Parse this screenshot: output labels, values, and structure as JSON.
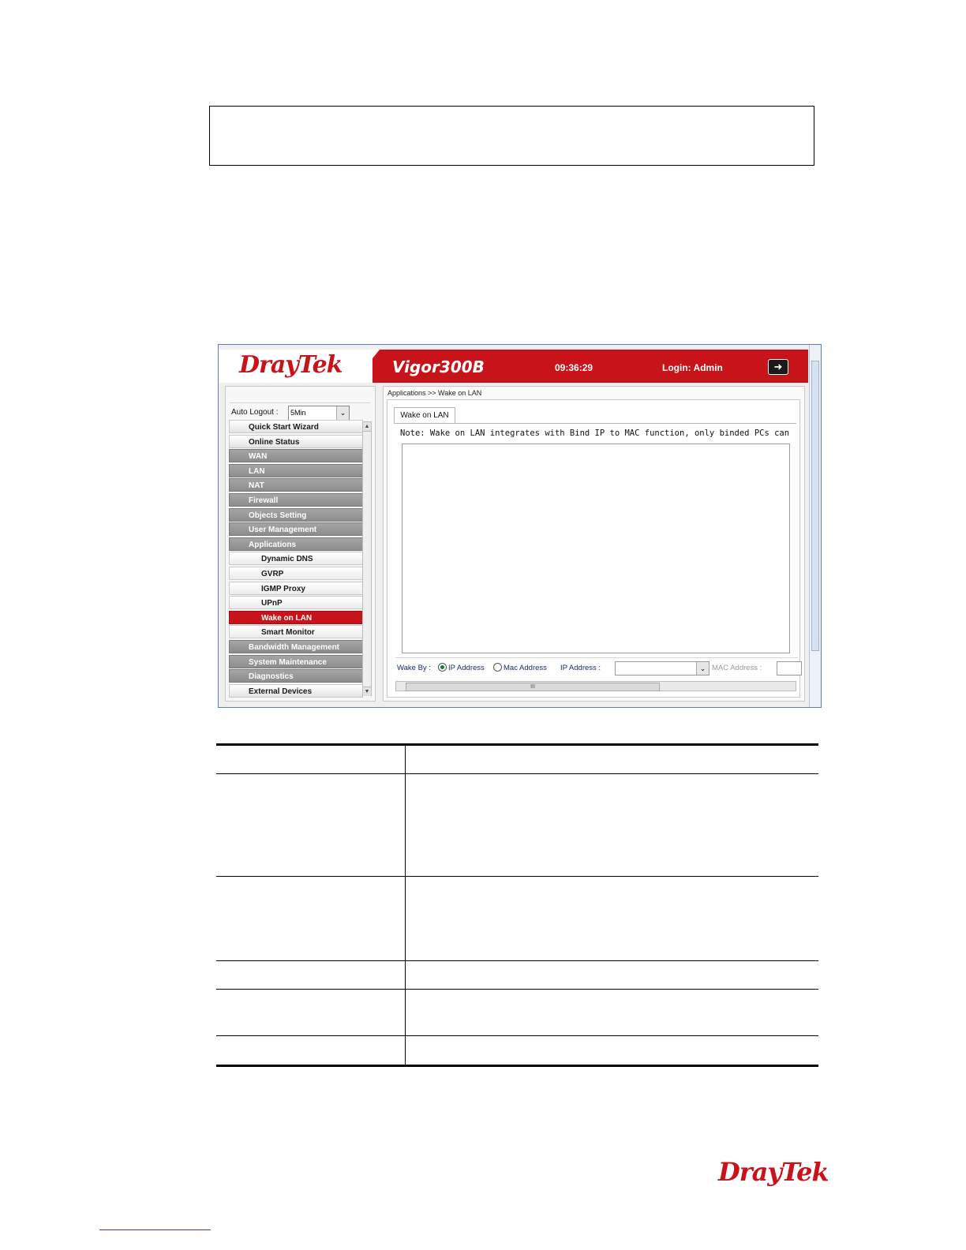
{
  "header": {
    "brand": "DrayTek",
    "model": "Vigor300B",
    "time": "09:36:29",
    "login": "Login: Admin",
    "logout_icon": "logout-arrow-icon"
  },
  "sidebar": {
    "auto_logout_label": "Auto Logout :",
    "auto_logout_value": "5Min",
    "items": [
      {
        "label": "Quick Start Wizard",
        "style": "light"
      },
      {
        "label": "Online Status",
        "style": "light"
      },
      {
        "label": "WAN",
        "style": "dark"
      },
      {
        "label": "LAN",
        "style": "dark"
      },
      {
        "label": "NAT",
        "style": "dark"
      },
      {
        "label": "Firewall",
        "style": "dark"
      },
      {
        "label": "Objects Setting",
        "style": "dark"
      },
      {
        "label": "User Management",
        "style": "dark"
      },
      {
        "label": "Applications",
        "style": "dark"
      },
      {
        "label": "Dynamic DNS",
        "style": "sub"
      },
      {
        "label": "GVRP",
        "style": "sub"
      },
      {
        "label": "IGMP Proxy",
        "style": "sub"
      },
      {
        "label": "UPnP",
        "style": "sub"
      },
      {
        "label": "Wake on LAN",
        "style": "active"
      },
      {
        "label": "Smart Monitor",
        "style": "sub"
      },
      {
        "label": "Bandwidth Management",
        "style": "dark"
      },
      {
        "label": "System Maintenance",
        "style": "dark"
      },
      {
        "label": "Diagnostics",
        "style": "dark"
      },
      {
        "label": "External Devices",
        "style": "light"
      }
    ]
  },
  "main": {
    "breadcrumb": "Applications >> Wake on LAN",
    "tab": "Wake on LAN",
    "note": "Note: Wake on LAN integrates with Bind IP to MAC function, only binded PCs can",
    "wake_by_label": "Wake By :",
    "option_ip": "IP Address",
    "option_mac": "Mac Address",
    "ip_address_label": "IP Address :",
    "mac_address_label": "MAC Address :",
    "hscroll_grip": "III"
  },
  "footer": {
    "brand": "DrayTek"
  },
  "colors": {
    "brand_red": "#c8131a",
    "menu_dark": "#9a9a9a"
  }
}
